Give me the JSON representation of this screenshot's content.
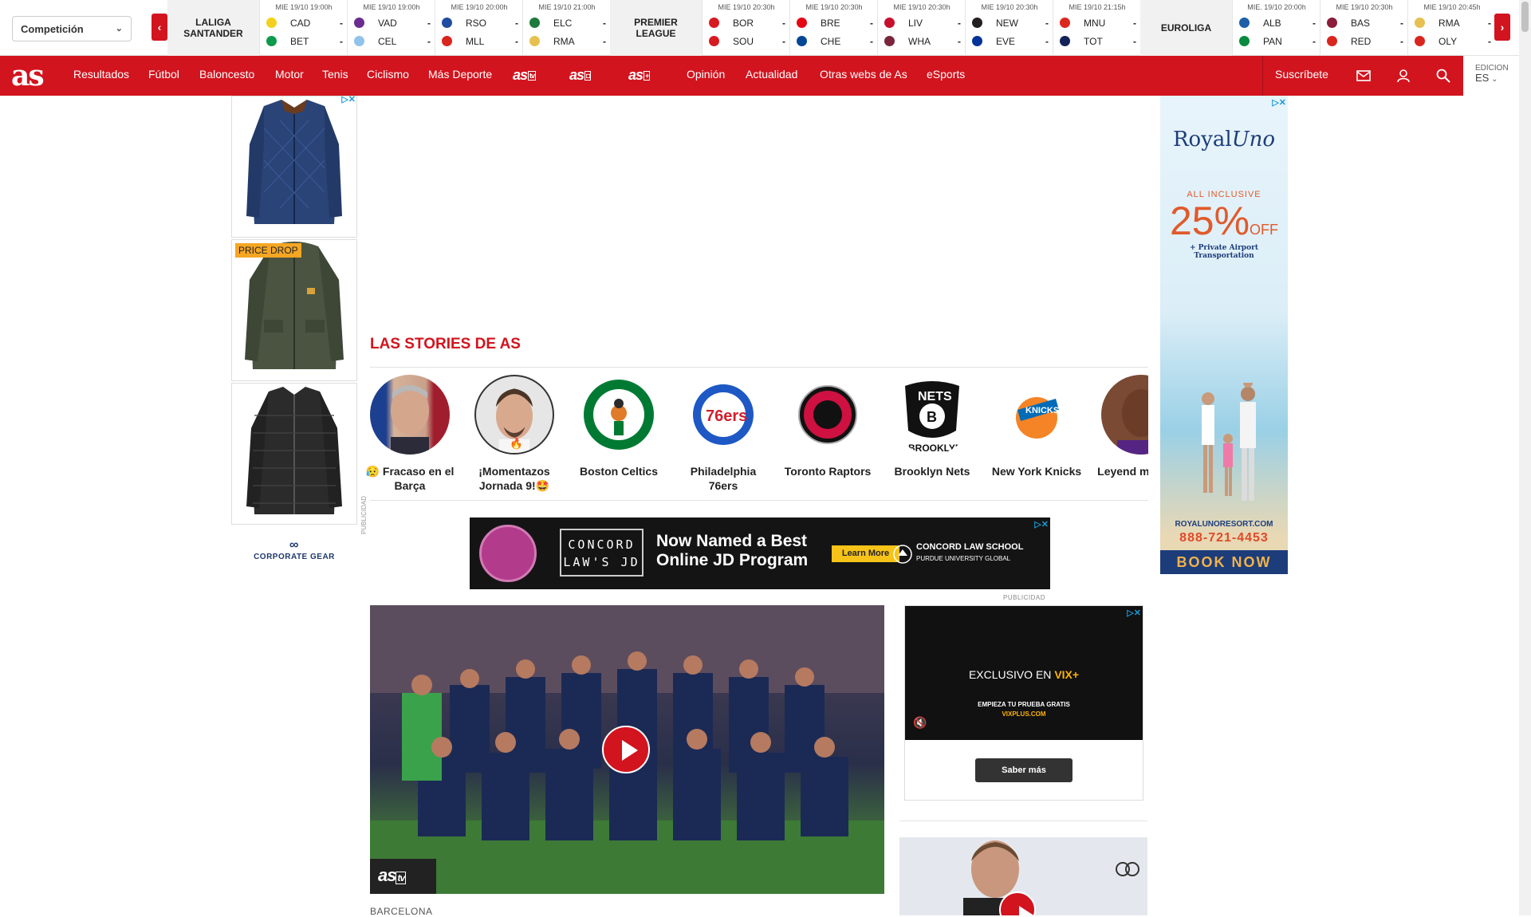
{
  "scorebar": {
    "competition_select": "Competición",
    "leagues": [
      {
        "name_line1": "LALIGA",
        "name_line2": "SANTANDER"
      },
      {
        "name_line1": "PREMIER",
        "name_line2": "LEAGUE"
      },
      {
        "name_line1": "EUROLIGA",
        "name_line2": ""
      }
    ],
    "matches": [
      {
        "date": "MIE 19/10 19:00h",
        "home": "CAD",
        "away": "BET",
        "home_score": "-",
        "away_score": "-",
        "home_color": "#f3d01b",
        "away_color": "#0a9a4a"
      },
      {
        "date": "MIE 19/10 19:00h",
        "home": "VAD",
        "away": "CEL",
        "home_score": "-",
        "away_score": "-",
        "home_color": "#6b2c8f",
        "away_color": "#8fc3ea"
      },
      {
        "date": "MIE 19/10 20:00h",
        "home": "RSO",
        "away": "MLL",
        "home_score": "-",
        "away_score": "-",
        "home_color": "#1f4da1",
        "away_color": "#d9251d"
      },
      {
        "date": "MIE 19/10 21:00h",
        "home": "ELC",
        "away": "RMA",
        "home_score": "-",
        "away_score": "-",
        "home_color": "#1d7a3c",
        "away_color": "#e6c050"
      },
      {
        "date": "MIE 19/10 20:30h",
        "home": "BOR",
        "away": "SOU",
        "home_score": "-",
        "away_score": "-",
        "home_color": "#d71920",
        "away_color": "#d71920"
      },
      {
        "date": "MIE 19/10 20:30h",
        "home": "BRE",
        "away": "CHE",
        "home_score": "-",
        "away_score": "-",
        "home_color": "#e30613",
        "away_color": "#034694"
      },
      {
        "date": "MIE 19/10 20:30h",
        "home": "LIV",
        "away": "WHA",
        "home_score": "-",
        "away_score": "-",
        "home_color": "#c8102e",
        "away_color": "#7a263a"
      },
      {
        "date": "MIE 19/10 20:30h",
        "home": "NEW",
        "away": "EVE",
        "home_score": "-",
        "away_score": "-",
        "home_color": "#241f20",
        "away_color": "#003399"
      },
      {
        "date": "MIE 19/10 21:15h",
        "home": "MNU",
        "away": "TOT",
        "home_score": "-",
        "away_score": "-",
        "home_color": "#da291c",
        "away_color": "#132257"
      },
      {
        "date": "MIE. 19/10 20:00h",
        "home": "ALB",
        "away": "PAN",
        "home_score": "-",
        "away_score": "-",
        "home_color": "#1f5fa8",
        "away_color": "#0a8a3e"
      },
      {
        "date": "MIE 19/10 20:30h",
        "home": "BAS",
        "away": "RED",
        "home_score": "-",
        "away_score": "-",
        "home_color": "#8b1c3b",
        "away_color": "#d9251d"
      },
      {
        "date": "MIE 19/10 20:45h",
        "home": "RMA",
        "away": "OLY",
        "home_score": "-",
        "away_score": "-",
        "home_color": "#e6c050",
        "away_color": "#d9251d"
      }
    ],
    "prev_icon": "chevron-left-icon",
    "next_icon": "chevron-right-icon"
  },
  "nav": {
    "brand": "as",
    "items": [
      "Resultados",
      "Fútbol",
      "Baloncesto",
      "Motor",
      "Tenis",
      "Ciclismo",
      "Más Deporte"
    ],
    "logos": [
      {
        "text": "as",
        "tag": "tv"
      },
      {
        "text": "as",
        "tag": "◘"
      },
      {
        "text": "as",
        "tag": "+"
      }
    ],
    "items2": [
      "Opinión",
      "Actualidad",
      "Otras webs de As",
      "eSports"
    ],
    "subscribe": "Suscríbete",
    "edition_label": "EDICION",
    "edition_value": "ES",
    "accent": "#d2141e"
  },
  "left_ad": {
    "price_drop": "PRICE DROP",
    "brand": "CORPORATE GEAR",
    "publicidad": "PUBLICIDAD"
  },
  "right_ad": {
    "logo_a": "Royal",
    "logo_b": "Uno",
    "all_inclusive": "ALL INCLUSIVE",
    "percent": "25%",
    "off": "OFF",
    "airport": "+ Private Airport Transportation",
    "url": "ROYALUNORESORT.COM",
    "phone": "888-721-4453",
    "book": "BOOK NOW"
  },
  "stories": {
    "title": "LAS STORIES DE AS",
    "items": [
      {
        "label": "😥 Fracaso en el Barça"
      },
      {
        "label": "¡Momentazos Jornada 9!🤩"
      },
      {
        "label": "Boston Celtics"
      },
      {
        "label": "Philadelphia 76ers"
      },
      {
        "label": "Toronto Raptors"
      },
      {
        "label": "Brooklyn Nets"
      },
      {
        "label": "New York Knicks"
      },
      {
        "label": "Leyend mate a L"
      }
    ]
  },
  "banner_ad": {
    "concord": "CONCORD LAW'S JD",
    "headline_1": "Now Named a Best",
    "headline_2": "Online JD Program",
    "cta": "Learn More",
    "school": "CONCORD LAW SCHOOL",
    "school_sub": "PURDUE UNIVERSITY GLOBAL",
    "publicidad": "PUBLICIDAD"
  },
  "video": {
    "badge": "as",
    "badge_tag": "tv",
    "caption": "BARCELONA"
  },
  "vix_ad": {
    "exclusive": "EXCLUSIVO EN",
    "brand": "VIX+",
    "trial": "EMPIEZA TU PRUEBA GRATIS",
    "url": "VIXPLUS.COM",
    "cta": "Saber más"
  }
}
